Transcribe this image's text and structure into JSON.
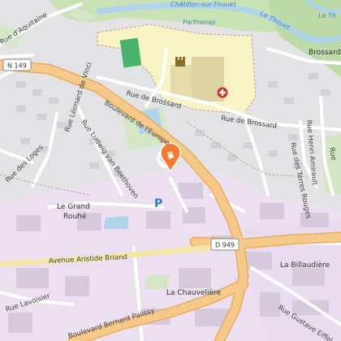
{
  "map": {
    "colors": {
      "residential": "#e3e3e6",
      "industrial": "#ecdff0",
      "hospital": "#f7f3c4",
      "green": "#d4e6c3",
      "forest": "#bddba8",
      "water": "#aed3ea",
      "major_road": "#f5c98a",
      "minor_road": "#ffffff",
      "marker": "#f27a32",
      "parking": "#2e7fcb"
    },
    "labels": {
      "town_top": "Châtillon-sur-Thouet",
      "parthenay": "Parthenay",
      "le_thouet": "Le Thouet",
      "le_thouet_top": "Le Th",
      "brossard_east": "Brossard",
      "rue_aquitaine": "Rue d'Aquitaine",
      "rue_brossard_1": "Rue de Brossard",
      "rue_brossard_2": "Rue de Brossard",
      "boulevard_europe": "Boulevard de l'Europe",
      "rue_ludwig": "Rue Ludwig van Beethoven",
      "rue_loges": "Rue des Loges",
      "rue_leonard": "Rue Léonard de Vinci",
      "rue_henri": "Rue Henri Amirault",
      "rue_terres_rouges": "Rue des Terres Rouges",
      "le_grand_rouhe": "Le Grand\nRouhé",
      "avenue_aristide": "Avenue Aristide Briand",
      "la_billaudiere": "La Billaudière",
      "la_chauveliere": "La Chauvelière",
      "rue_lavoisier": "Rue Lavoisier",
      "boulevard_palissy": "Boulevard Bernard Palissy",
      "rue_gustave": "Rue Gustave Eiffel",
      "rue_partial_right": "Rue"
    },
    "shields": {
      "n149": "N 149",
      "d949": "D 949"
    },
    "icons": {
      "marker": "location-pin-icon",
      "parking": "parking-icon",
      "hospital": "hospital-icon",
      "castle": "castle-icon"
    },
    "parking_letter": "P"
  }
}
